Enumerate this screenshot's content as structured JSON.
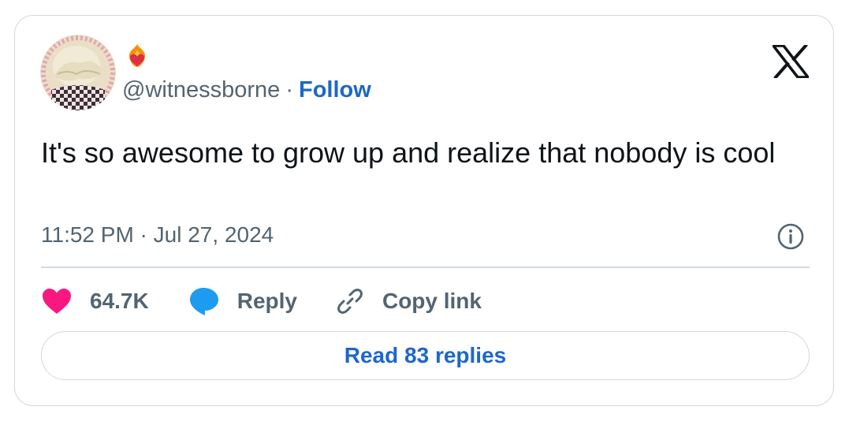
{
  "author": {
    "handle": "@witnessborne",
    "separator": "·",
    "follow_label": "Follow",
    "badge_emoji": "heart-on-fire"
  },
  "tweet": {
    "text": "It's so awesome to grow up and realize that nobody is cool",
    "timestamp": "11:52 PM · Jul 27, 2024"
  },
  "actions": {
    "likes_count": "64.7K",
    "reply_label": "Reply",
    "copy_link_label": "Copy link"
  },
  "read_replies_label": "Read 83 replies",
  "icons": {
    "brand": "x-logo-icon",
    "info": "info-icon",
    "like": "heart-icon",
    "reply": "speech-bubble-icon",
    "copy": "link-icon"
  },
  "colors": {
    "like": "#f91880",
    "reply": "#1d9bf0",
    "accent": "#1d67c9",
    "text": "#0f1419",
    "secondary": "#536471",
    "border": "#cfd9de"
  }
}
